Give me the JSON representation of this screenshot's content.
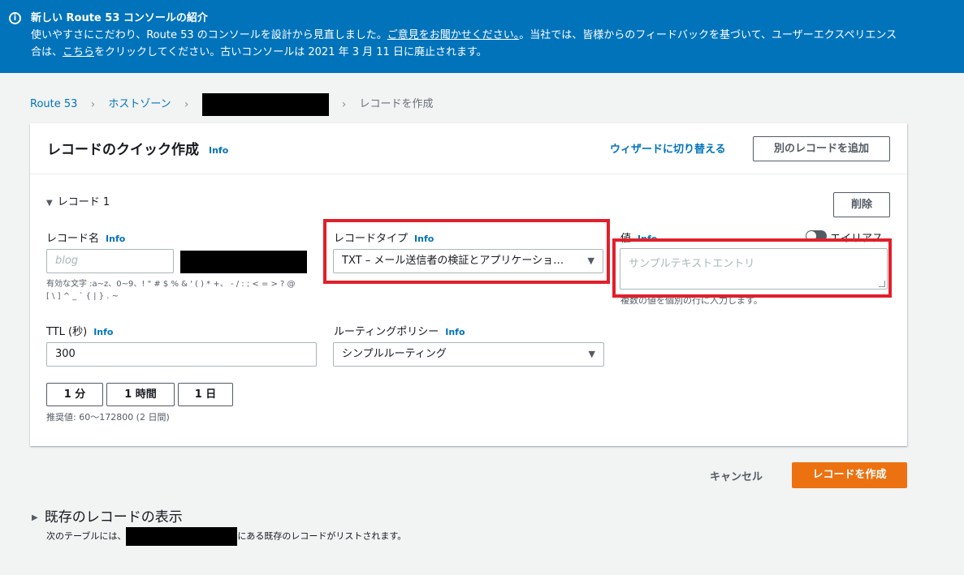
{
  "banner": {
    "icon": "info-icon",
    "title": "新しい Route 53 コンソールの紹介",
    "line1_a": "使いやすさにこだわり、Route 53 のコンソールを設計から見直しました。",
    "line1_link": "ご意見をお聞かせください。",
    "line1_b": "。当社では、皆様からのフィードバックを基づいて、ユーザーエクスペリエンス",
    "line2_a": "合は、",
    "line2_link": "こちら",
    "line2_b": "をクリックしてください。古いコンソールは 2021 年 3 月 11 日に廃止されます。"
  },
  "breadcrumb": {
    "items": [
      "Route 53",
      "ホストゾーン"
    ],
    "current": "レコードを作成"
  },
  "panel": {
    "title": "レコードのクイック作成",
    "info": "Info",
    "wizard_link": "ウィザードに切り替える",
    "add_record": "別のレコードを追加"
  },
  "record": {
    "toggle_label": "レコード 1",
    "delete": "削除",
    "name": {
      "label": "レコード名",
      "info": "Info",
      "placeholder": "blog",
      "hint_line1": "有効な文字 :a~z、0~9、! \" # $ % & ' ( ) * +、 - / : ; < = > ? @",
      "hint_line2": "[ \\ ] ^ _ ` { | } . ~"
    },
    "type": {
      "label": "レコードタイプ",
      "info": "Info",
      "value": "TXT – メール送信者の検証とアプリケーショ…"
    },
    "value": {
      "label": "値",
      "info": "Info",
      "alias_label": "エイリアス",
      "placeholder": "サンプルテキストエントリ",
      "hint": "複数の値を個別の行に入力します。"
    },
    "ttl": {
      "label": "TTL (秒)",
      "info": "Info",
      "value": "300",
      "buttons": [
        "1 分",
        "1 時間",
        "1 日"
      ],
      "hint": "推奨値: 60～172800 (2 日間)"
    },
    "routing": {
      "label": "ルーティングポリシー",
      "info": "Info",
      "value": "シンプルルーティング"
    }
  },
  "footer": {
    "cancel": "キャンセル",
    "create": "レコードを作成"
  },
  "existing": {
    "title": "既存のレコードの表示",
    "desc_a": "次のテーブルには、",
    "desc_b": "にある既存のレコードがリストされます。"
  },
  "colors": {
    "banner": "#0073bb",
    "link": "#0073bb",
    "primary_button": "#ec7211",
    "highlight_box": "#e0202b"
  }
}
